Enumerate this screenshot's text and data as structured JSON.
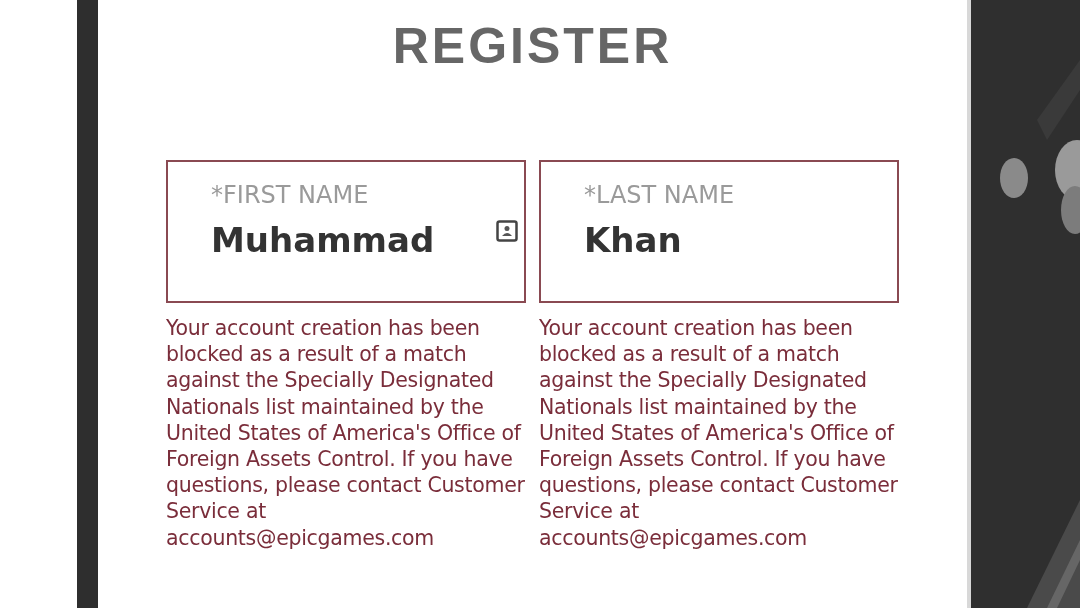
{
  "title": "REGISTER",
  "fields": [
    {
      "label": "*FIRST NAME",
      "value": "Muhammad",
      "autofill_icon": true,
      "error": "Your account creation has been blocked as a result of a match against the Specially Designated Nationals list maintained by the United States of America's Office of Foreign Assets Control. If you have questions, please contact Customer Service at accounts@epicgames.com"
    },
    {
      "label": "*LAST NAME",
      "value": "Khan",
      "autofill_icon": false,
      "error": "Your account creation has been blocked as a result of a match against the Specially Designated Nationals list maintained by the United States of America's Office of Foreign Assets Control. If you have questions, please contact Customer Service at accounts@epicgames.com"
    }
  ]
}
